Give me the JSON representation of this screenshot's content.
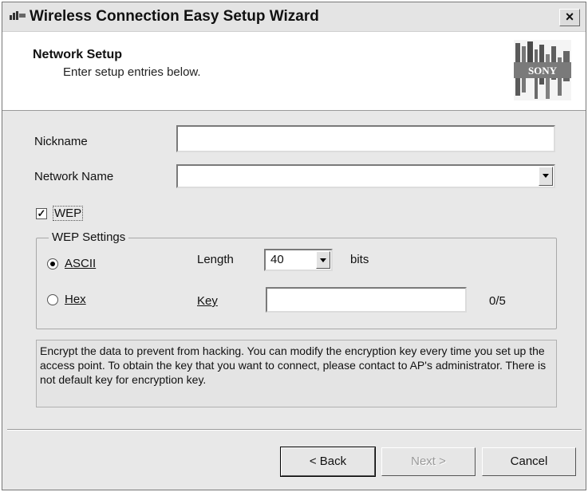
{
  "window": {
    "title": "Wireless Connection Easy Setup Wizard",
    "close_label": "×"
  },
  "header": {
    "title": "Network Setup",
    "subtitle": "Enter setup entries below.",
    "logo_text": "SONY"
  },
  "form": {
    "nickname_label": "Nickname",
    "nickname_value": "",
    "network_name_label": "Network Name",
    "network_name_value": "",
    "wep_label": "WEP",
    "wep_checked": true,
    "wep_check_mark": "✓",
    "wep_settings": {
      "group_label": "WEP Settings",
      "ascii_label": "ASCII",
      "ascii_selected": true,
      "hex_label": "Hex",
      "hex_selected": false,
      "length_label": "Length",
      "length_value": "40",
      "length_unit": "bits",
      "key_label": "Key",
      "key_value": "",
      "key_counter": "0/5"
    }
  },
  "description": "Encrypt the data to prevent from hacking. You can modify the encryption key every time you set up the access point. To obtain the key that you want to connect, please contact to AP's administrator. There is not default key for encryption key.",
  "buttons": {
    "back": "< Back",
    "next": "Next >",
    "cancel": "Cancel",
    "next_enabled": false
  }
}
